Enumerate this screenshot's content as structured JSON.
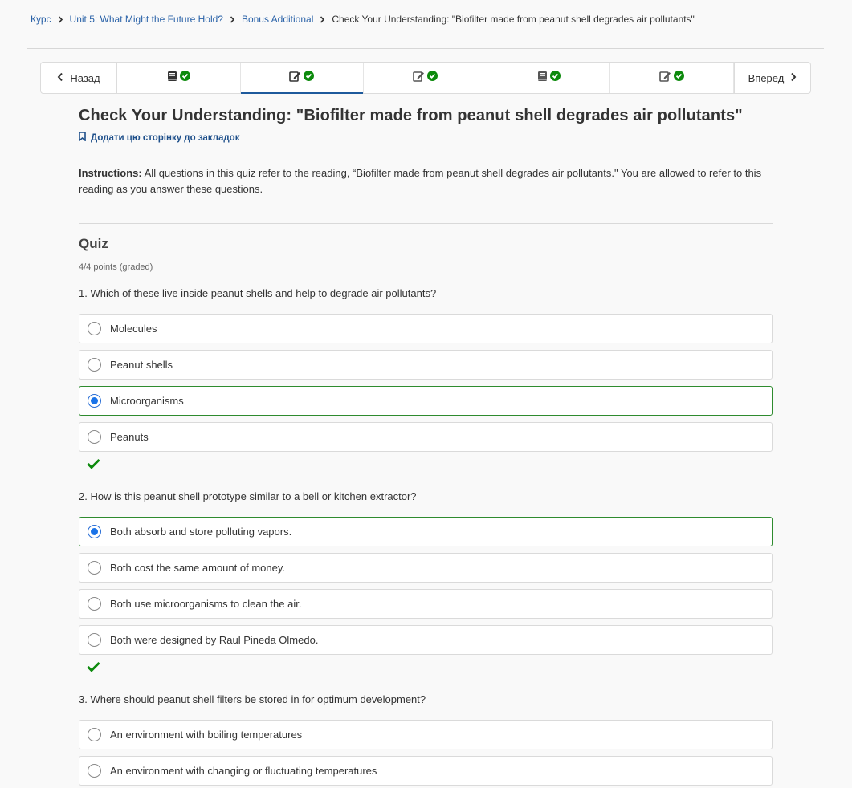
{
  "breadcrumb": {
    "items": [
      "Курс",
      "Unit 5: What Might the Future Hold?",
      "Bonus Additional"
    ],
    "current": "Check Your Understanding: \"Biofilter made from peanut shell degrades air pollutants\""
  },
  "nav": {
    "prev_label": "Назад",
    "next_label": "Вперед",
    "units": [
      {
        "icon": "book-icon",
        "complete": true,
        "active": false
      },
      {
        "icon": "edit-icon",
        "complete": true,
        "active": true
      },
      {
        "icon": "edit-icon",
        "complete": true,
        "active": false
      },
      {
        "icon": "book-icon",
        "complete": true,
        "active": false
      },
      {
        "icon": "edit-icon",
        "complete": true,
        "active": false
      }
    ]
  },
  "page": {
    "title": "Check Your Understanding: \"Biofilter made from peanut shell degrades air pollutants\"",
    "bookmark_label": "Додати цю сторінку до закладок",
    "instructions_label": "Instructions:",
    "instructions_text": " All questions in this quiz refer to the reading, “Biofilter made from peanut shell degrades air pollutants.\" You are allowed to refer to this reading as you answer these questions."
  },
  "quiz": {
    "heading": "Quiz",
    "points": "4/4 points (graded)",
    "questions": [
      {
        "text": "1. Which of these live inside peanut shells and help to degrade air pollutants?",
        "options": [
          "Molecules",
          "Peanut shells",
          "Microorganisms",
          "Peanuts"
        ],
        "selected": 2,
        "correct": true
      },
      {
        "text": "2. How is this peanut shell prototype similar to a bell or kitchen extractor?",
        "options": [
          "Both absorb and store polluting vapors.",
          "Both cost the same amount of money.",
          "Both use microorganisms to clean the air.",
          "Both were designed by Raul Pineda Olmedo."
        ],
        "selected": 0,
        "correct": true
      },
      {
        "text": "3. Where should peanut shell filters be stored in for optimum development?",
        "options": [
          "An environment with boiling temperatures",
          "An environment with changing or fluctuating temperatures"
        ],
        "selected": null,
        "correct": null
      }
    ]
  },
  "colors": {
    "link": "#2a62a8",
    "check_green": "#0d8a0d",
    "selected_border": "#2e8b2e",
    "radio_blue": "#1a73e8",
    "active_tab": "#1e5a9c"
  }
}
